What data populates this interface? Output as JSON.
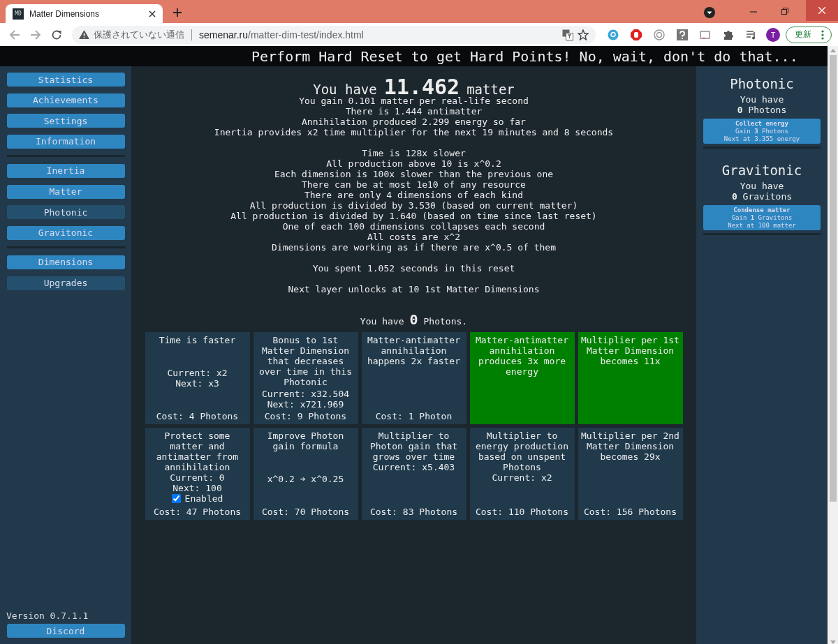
{
  "browser": {
    "tab": {
      "favicon_text": "MD",
      "title": "Matter Dimensions"
    },
    "address": {
      "warning": "保護されていない通信",
      "domain": "semenar.ru",
      "path": "/matter-dim-test/index.html"
    },
    "profile_initial": "T",
    "update_button": "更新"
  },
  "banner": "Perform Hard Reset to get Hard Points! No, wait, don't do that...",
  "sidebar": {
    "groups": [
      [
        {
          "label": "Statistics",
          "selected": false
        },
        {
          "label": "Achievements",
          "selected": false
        },
        {
          "label": "Settings",
          "selected": false
        },
        {
          "label": "Information",
          "selected": false
        }
      ],
      [
        {
          "label": "Inertia",
          "selected": false
        },
        {
          "label": "Matter",
          "selected": false
        },
        {
          "label": "Photonic",
          "selected": true
        },
        {
          "label": "Gravitonic",
          "selected": false
        }
      ],
      [
        {
          "label": "Dimensions",
          "selected": false
        },
        {
          "label": "Upgrades",
          "selected": true
        }
      ]
    ],
    "version": "Version 0.7.1.1",
    "discord": "Discord"
  },
  "main": {
    "matter": {
      "prefix": "You have",
      "amount": "11.462",
      "suffix": "matter"
    },
    "stat_groups": [
      [
        "You gain 0.101 matter per real-life second",
        "There is 1.444 antimatter",
        "Annihilation produced 2.299 energy so far",
        "Inertia provides x2 time multiplier for the next 19 minutes and 8 seconds"
      ],
      [
        "Time is 128x slower",
        "All production above 10 is x^0.2",
        "Each dimension is 100x slower than the previous one",
        "There can be at most 1e10 of any resource",
        "There are only 4 dimensions of each kind",
        "All production is divided by 3.530 (based on current matter)",
        "All production is divided by 1.640 (based on time since last reset)",
        "One of each 100 dimensions collapses each second",
        "All costs are x^2",
        "Dimensions are working as if there are x^0.5 of them"
      ],
      [
        "You spent 1.052 seconds in this reset"
      ],
      [
        "Next layer unlocks at 10 1st Matter Dimensions"
      ]
    ],
    "photons": {
      "prefix": "You have",
      "amount": "0",
      "suffix": "Photons."
    },
    "upgrades": [
      {
        "title": "Time is faster",
        "effect": [
          "Current: x2",
          "Next: x3"
        ],
        "cost": "Cost: 4 Photons",
        "bought": false
      },
      {
        "title": "Bonus to 1st Matter Dimension that decreases over time in this Photonic",
        "effect": [
          "Current: x32.504",
          "Next: x721.969"
        ],
        "cost": "Cost: 9 Photons",
        "bought": false
      },
      {
        "title": "Matter-antimatter annihilation happens 2x faster",
        "cost": "Cost: 1 Photon",
        "bought": false
      },
      {
        "title": "Matter-antimatter annihilation produces 3x more energy",
        "bought": true
      },
      {
        "title": "Multiplier per 1st Matter Dimension becomes 11x",
        "bought": true
      },
      {
        "title": "Protect some matter and antimatter from annihilation",
        "info": [
          "Current: 0",
          "Next: 100"
        ],
        "toggle": {
          "label": "Enabled",
          "checked": true
        },
        "cost": "Cost: 47 Photons",
        "bought": false
      },
      {
        "title": "Improve Photon gain formula",
        "effect": [
          "x^0.2 ➔ x^0.25"
        ],
        "cost": "Cost: 70 Photons",
        "bought": false
      },
      {
        "title": "Multiplier to Photon gain that grows over time",
        "info": [
          "Current: x5.403"
        ],
        "cost": "Cost: 83 Photons",
        "bought": false
      },
      {
        "title": "Multiplier to energy production based on unspent Photons",
        "info": [
          "Current: x2"
        ],
        "cost": "Cost: 110 Photons",
        "bought": false
      },
      {
        "title": "Multiplier per 2nd Matter Dimension becomes 29x",
        "cost": "Cost: 156 Photons",
        "bought": false
      }
    ]
  },
  "layers": [
    {
      "title": "Photonic",
      "have": "You have",
      "amount": "**0** Photons",
      "button": {
        "title": "Collect energy",
        "gain": "Gain **3** Photons",
        "next": "Next at 3.355 energy"
      }
    },
    {
      "title": "Gravitonic",
      "have": "You have",
      "amount": "**0** Gravitons",
      "button": {
        "title": "Condense matter",
        "gain": "Gain **1** Gravitons",
        "next": "Next at 100 matter"
      }
    }
  ]
}
